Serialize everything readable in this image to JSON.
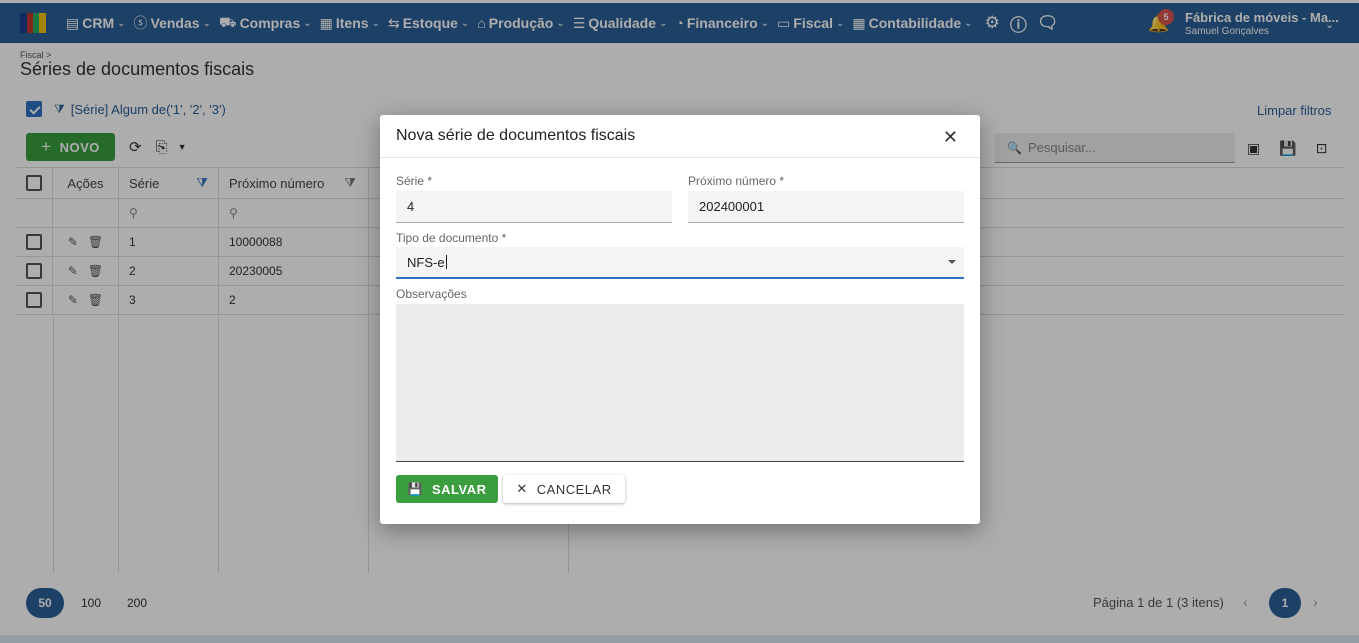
{
  "nav": {
    "items": [
      {
        "label": "CRM",
        "icon": "▤"
      },
      {
        "label": "Vendas",
        "icon": "$"
      },
      {
        "label": "Compras",
        "icon": "🛒"
      },
      {
        "label": "Itens",
        "icon": "▦"
      },
      {
        "label": "Estoque",
        "icon": "⇆"
      },
      {
        "label": "Produção",
        "icon": "⌂"
      },
      {
        "label": "Qualidade",
        "icon": "☰"
      },
      {
        "label": "Financeiro",
        "icon": "◔"
      },
      {
        "label": "Fiscal",
        "icon": "▭"
      },
      {
        "label": "Contabilidade",
        "icon": "▦"
      }
    ],
    "notification_count": "5",
    "company_name": "Fábrica de móveis - Ma...",
    "user_name": "Samuel Gonçalves"
  },
  "page": {
    "breadcrumb": "Fiscal >",
    "title": "Séries de documentos fiscais",
    "filter_text": "[Série] Algum de('1', '2', '3')",
    "clear_filters": "Limpar filtros",
    "new_button": "NOVO",
    "search_placeholder": "Pesquisar..."
  },
  "grid": {
    "headers": {
      "actions": "Ações",
      "serie": "Série",
      "next_number": "Próximo número"
    },
    "rows": [
      {
        "serie": "1",
        "next_number": "10000088"
      },
      {
        "serie": "2",
        "next_number": "20230005"
      },
      {
        "serie": "3",
        "next_number": "2"
      }
    ]
  },
  "pager": {
    "sizes": [
      "50",
      "100",
      "200"
    ],
    "active_size": "50",
    "info": "Página 1 de 1 (3 itens)",
    "current_page": "1"
  },
  "modal": {
    "title": "Nova série de documentos fiscais",
    "serie_label": "Série *",
    "serie_value": "4",
    "next_number_label": "Próximo número *",
    "next_number_value": "202400001",
    "doc_type_label": "Tipo de documento *",
    "doc_type_value": "NFS-e",
    "notes_label": "Observações",
    "save_label": "SALVAR",
    "cancel_label": "CANCELAR"
  },
  "colors": {
    "topbar": "#2b5f97",
    "primary_green": "#3a9e3e",
    "accent_blue": "#2b72c2",
    "badge_red": "#d9534f"
  }
}
